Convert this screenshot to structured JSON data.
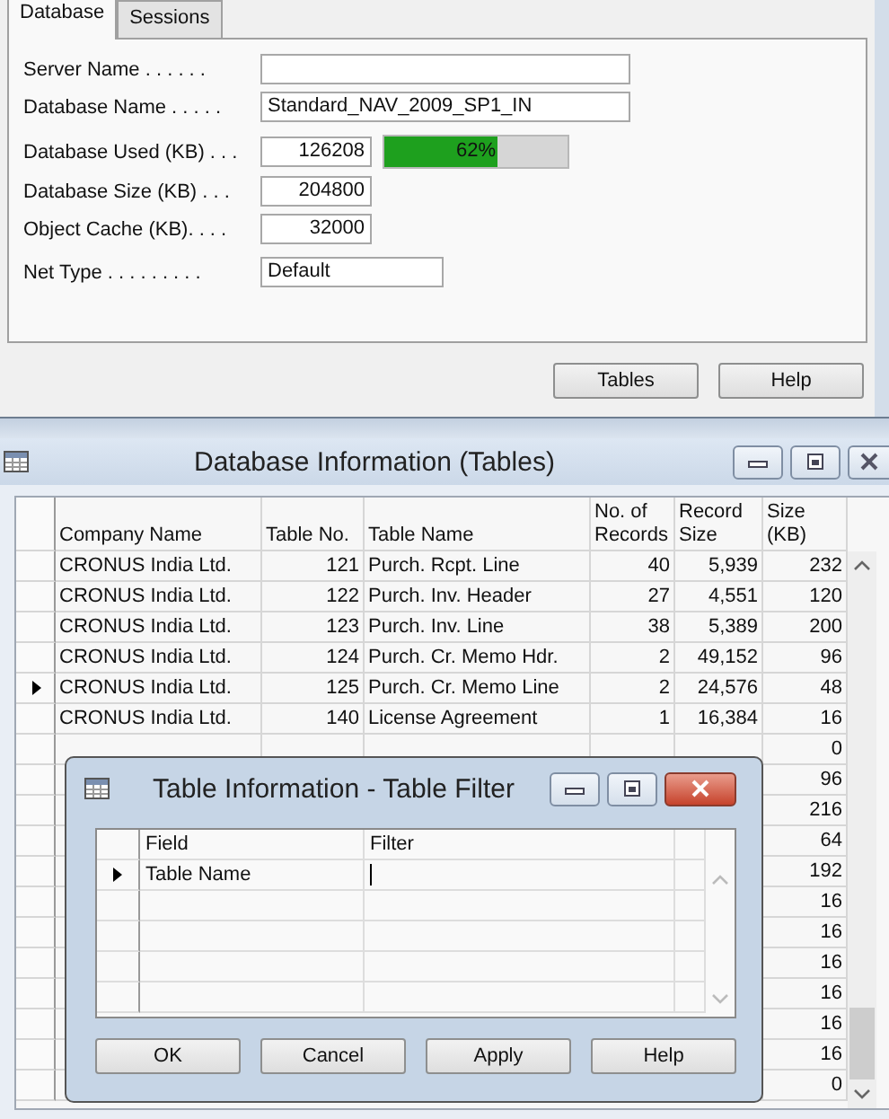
{
  "tabs": [
    {
      "label": "Database",
      "selected": true
    },
    {
      "label": "Sessions",
      "selected": false
    }
  ],
  "fields": [
    {
      "kind": "text",
      "label": "Server Name . . . . . ."
    },
    {
      "kind": "text",
      "label": "Database Name . . . . .",
      "value": "Standard_NAV_2009_SP1_IN"
    },
    {
      "kind": "number",
      "label": "Database Used (KB) . . .",
      "value": "126208",
      "level": 0.62,
      "reading": "62%"
    },
    {
      "kind": "number",
      "label": "Database Size (KB)  . . .",
      "value": "204800"
    },
    {
      "kind": "number",
      "label": "Object Cache (KB). . . .",
      "value": "32000"
    },
    {
      "kind": "short",
      "label": "Net Type . . . . . . . . .",
      "value": "Default"
    }
  ],
  "buttons": [
    "Tables",
    "Help"
  ],
  "tables_window": {
    "title": "Database Information (Tables)",
    "columns": [
      "Company Name",
      "Table No.",
      "Table Name",
      "No. of Records",
      "Record Size",
      "Size (KB)"
    ],
    "rows": [
      {
        "company": "CRONUS India Ltd.",
        "table_no": "121",
        "table_name": "Purch. Rcpt. Line",
        "records": "40",
        "record_size": "5,939",
        "size_kb": "232",
        "selected": false
      },
      {
        "company": "CRONUS India Ltd.",
        "table_no": "122",
        "table_name": "Purch. Inv. Header",
        "records": "27",
        "record_size": "4,551",
        "size_kb": "120",
        "selected": false
      },
      {
        "company": "CRONUS India Ltd.",
        "table_no": "123",
        "table_name": "Purch. Inv. Line",
        "records": "38",
        "record_size": "5,389",
        "size_kb": "200",
        "selected": false
      },
      {
        "company": "CRONUS India Ltd.",
        "table_no": "124",
        "table_name": "Purch. Cr. Memo Hdr.",
        "records": "2",
        "record_size": "49,152",
        "size_kb": "96",
        "selected": false
      },
      {
        "company": "CRONUS India Ltd.",
        "table_no": "125",
        "table_name": "Purch. Cr. Memo Line",
        "records": "2",
        "record_size": "24,576",
        "size_kb": "48",
        "selected": true
      },
      {
        "company": "CRONUS India Ltd.",
        "table_no": "140",
        "table_name": "License Agreement",
        "records": "1",
        "record_size": "16,384",
        "size_kb": "16",
        "selected": false
      },
      {
        "size_kb": "0",
        "selected": false
      },
      {
        "size_kb": "96",
        "selected": false
      },
      {
        "size_kb": "216",
        "selected": false
      },
      {
        "size_kb": "64",
        "selected": false
      },
      {
        "size_kb": "192",
        "selected": false
      },
      {
        "size_kb": "16",
        "selected": false
      },
      {
        "size_kb": "16",
        "selected": false
      },
      {
        "size_kb": "16",
        "selected": false
      },
      {
        "size_kb": "16",
        "selected": false
      },
      {
        "size_kb": "16",
        "selected": false
      },
      {
        "size_kb": "16",
        "selected": false
      },
      {
        "size_kb": "0",
        "selected": false
      }
    ]
  },
  "filter_dialog": {
    "title": "Table Information - Table Filter",
    "columns": [
      "Field",
      "Filter"
    ],
    "rows": [
      {
        "field": "Table Name",
        "selected": true
      },
      {
        "selected": false
      },
      {
        "selected": false
      },
      {
        "selected": false
      },
      {
        "selected": false
      }
    ],
    "buttons": [
      "OK",
      "Cancel",
      "Apply",
      "Help"
    ]
  }
}
